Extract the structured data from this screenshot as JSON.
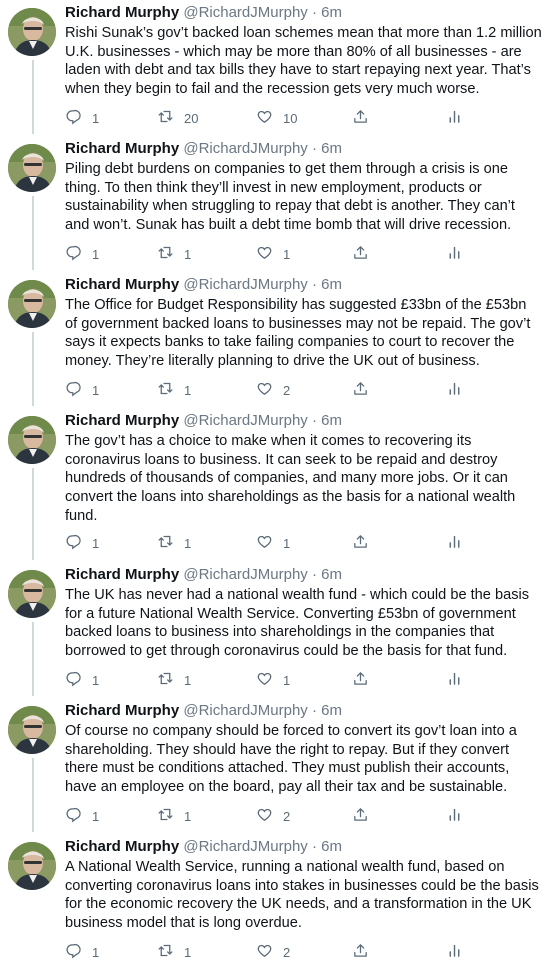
{
  "tweets": [
    {
      "name": "Richard Murphy",
      "handle": "@RichardJMurphy",
      "time": "6m",
      "lines": [
        "Rishi Sunak’s gov’t backed loan schemes mean that more than 1.2 million",
        "U.K. businesses - which may be more than 80% of all businesses - are",
        "laden with debt and tax bills they have to start repaying next year. That’s",
        "when they begin to fail and the recession gets very much worse."
      ],
      "replies": "1",
      "retweets": "20",
      "likes": "10"
    },
    {
      "name": "Richard Murphy",
      "handle": "@RichardJMurphy",
      "time": "6m",
      "lines": [
        "Piling debt burdens on companies to get them through a crisis is one",
        "thing. To then think they’ll  invest in new employment, products or",
        "sustainability when struggling to repay that debt is another. They can’t",
        "and won’t. Sunak has built a debt time bomb that will drive recession."
      ],
      "replies": "1",
      "retweets": "1",
      "likes": "1"
    },
    {
      "name": "Richard Murphy",
      "handle": "@RichardJMurphy",
      "time": "6m",
      "lines": [
        "The Office for Budget Responsibility has suggested £33bn of the £53bn",
        "of government backed loans to businesses may not be repaid. The gov’t",
        "says it  expects banks to take failing companies to court to recover the",
        "money. They’re literally planning to drive the UK out of business."
      ],
      "replies": "1",
      "retweets": "1",
      "likes": "2"
    },
    {
      "name": "Richard Murphy",
      "handle": "@RichardJMurphy",
      "time": "6m",
      "lines": [
        "The gov’t has a choice to make when it comes to recovering its",
        "coronavirus loans to business. It can seek to be repaid and destroy",
        "hundreds of thousands of companies, and many more jobs. Or it can",
        "convert the loans into shareholdings as the basis for a national wealth",
        "fund."
      ],
      "replies": "1",
      "retweets": "1",
      "likes": "1"
    },
    {
      "name": "Richard Murphy",
      "handle": "@RichardJMurphy",
      "time": "6m",
      "lines": [
        "The UK has never had a national wealth fund - which could be the basis",
        "for a future National Wealth Service. Converting £53bn of government",
        "backed loans to business into shareholdings in the companies that",
        "borrowed to get through coronavirus could be the basis for that fund."
      ],
      "replies": "1",
      "retweets": "1",
      "likes": "1"
    },
    {
      "name": "Richard Murphy",
      "handle": "@RichardJMurphy",
      "time": "6m",
      "lines": [
        "Of course no company should be forced to convert its gov’t loan into a",
        "shareholding. They should have the right to repay. But if they convert",
        "there must be conditions attached. They must publish their accounts,",
        "have an employee on the board, pay all their tax and be sustainable."
      ],
      "replies": "1",
      "retweets": "1",
      "likes": "2"
    },
    {
      "name": "Richard Murphy",
      "handle": "@RichardJMurphy",
      "time": "6m",
      "lines": [
        "A National Wealth Service, running a national wealth fund, based on",
        "converting coronavirus loans into stakes in businesses could be the basis",
        "for the economic recovery the UK needs, and a transformation in the UK",
        "business model that is long overdue."
      ],
      "replies": "1",
      "retweets": "1",
      "likes": "2"
    }
  ]
}
